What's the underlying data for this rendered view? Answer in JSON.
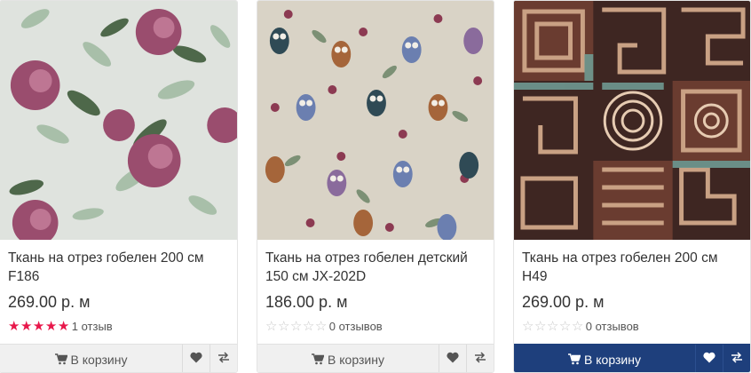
{
  "products": [
    {
      "title": "Ткань на отрез гобелен 200 см F186",
      "price": "269.00 р. м",
      "rating": 5,
      "reviews": "1 отзыв",
      "cart_label": "В корзину",
      "image": "floral-rose-tapestry"
    },
    {
      "title": "Ткань на отрез гобелен детский 150 см JX-202D",
      "price": "186.00 р. м",
      "rating": 0,
      "reviews": "0 отзывов",
      "cart_label": "В корзину",
      "image": "owls-tapestry"
    },
    {
      "title": "Ткань на отрез гобелен 200 см H49",
      "price": "269.00 р. м",
      "rating": 0,
      "reviews": "0 отзывов",
      "cart_label": "В корзину",
      "image": "ethnic-geometric-tapestry"
    }
  ],
  "icons": {
    "cart": "cart-icon",
    "wishlist": "heart-icon",
    "compare": "compare-arrows-icon",
    "star": "star-icon"
  },
  "colors": {
    "star_active": "#e8174a",
    "star_inactive": "#c9c9c9",
    "action_bar": "#f0f0f0",
    "action_bar_active": "#1e3f7c"
  }
}
